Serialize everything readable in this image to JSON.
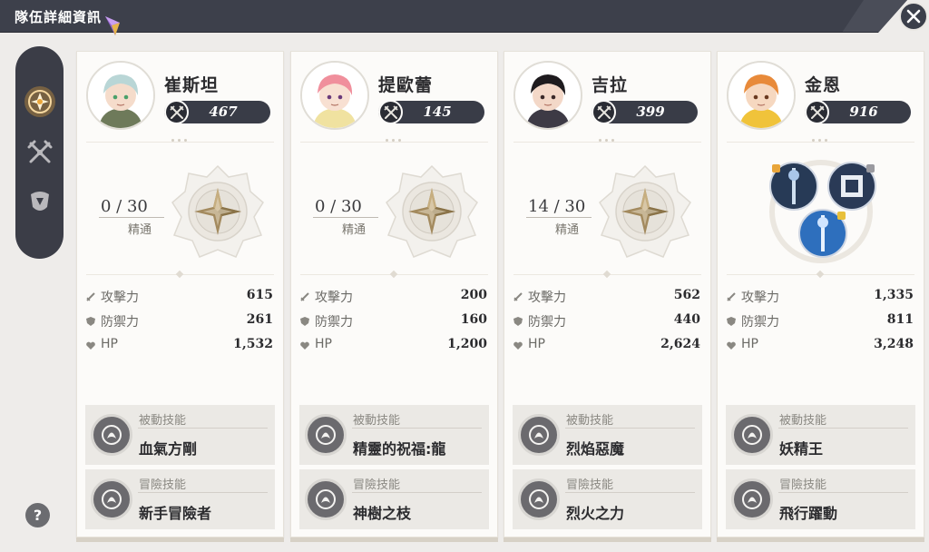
{
  "header": {
    "title": "隊伍詳細資訊"
  },
  "colors": {
    "header_bg": "#3d404b",
    "accent": "#e9a53a",
    "power_bg": "#393c47"
  },
  "sidebar": {
    "items": [
      {
        "icon": "team-emblem-icon",
        "active": true
      },
      {
        "icon": "crossed-weapons-icon",
        "active": false
      },
      {
        "icon": "armor-icon",
        "active": false
      }
    ]
  },
  "help": {
    "label": "?"
  },
  "stat_labels": {
    "attack": "攻擊力",
    "defense": "防禦力",
    "hp": "HP"
  },
  "skill_labels": {
    "passive": "被動技能",
    "adventure": "冒險技能"
  },
  "mastery_label": "精通",
  "characters": [
    {
      "name": "崔斯坦",
      "power": "467",
      "mastery": "0 / 30",
      "attack": "615",
      "defense": "261",
      "hp": "1,532",
      "passive_skill": "血氣方剛",
      "adventure_skill": "新手冒險者",
      "avatar_icon": "tristan-portrait-icon"
    },
    {
      "name": "提歐蕾",
      "power": "145",
      "mastery": "0 / 30",
      "attack": "200",
      "defense": "160",
      "hp": "1,200",
      "passive_skill": "精靈的祝福:龍",
      "adventure_skill": "神樹之枝",
      "avatar_icon": "tioreh-portrait-icon"
    },
    {
      "name": "吉拉",
      "power": "399",
      "mastery": "14 / 30",
      "attack": "562",
      "defense": "440",
      "hp": "2,624",
      "passive_skill": "烈焰惡魔",
      "adventure_skill": "烈火之力",
      "avatar_icon": "jericho-portrait-icon"
    },
    {
      "name": "金恩",
      "power": "916",
      "mastery": "",
      "attack": "1,335",
      "defense": "811",
      "hp": "3,248",
      "passive_skill": "妖精王",
      "adventure_skill": "飛行躍動",
      "avatar_icon": "king-portrait-icon"
    }
  ]
}
